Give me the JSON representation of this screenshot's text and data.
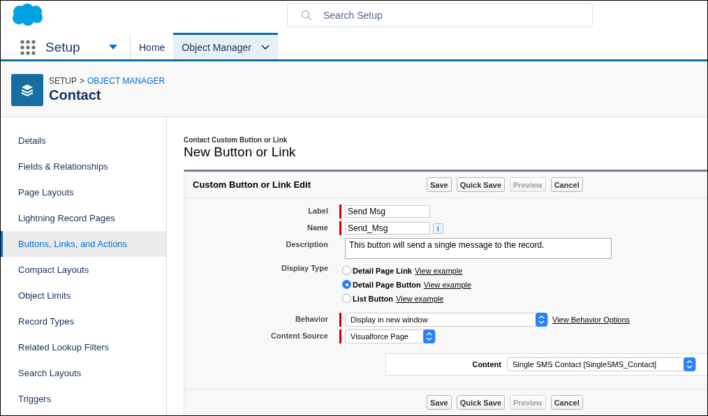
{
  "header": {
    "search": {
      "placeholder": "Search Setup"
    }
  },
  "nav": {
    "app_name": "Setup",
    "tabs": [
      {
        "label": "Home",
        "selected": false,
        "menu": false
      },
      {
        "label": "Object Manager",
        "selected": true,
        "menu": true
      }
    ]
  },
  "object_header": {
    "breadcrumb": [
      {
        "label": "SETUP",
        "link": false
      },
      {
        "label": "OBJECT MANAGER",
        "link": true
      }
    ],
    "separator": ">",
    "title": "Contact"
  },
  "sidebar": {
    "items": [
      {
        "label": "Details",
        "selected": false
      },
      {
        "label": "Fields & Relationships",
        "selected": false
      },
      {
        "label": "Page Layouts",
        "selected": false
      },
      {
        "label": "Lightning Record Pages",
        "selected": false
      },
      {
        "label": "Buttons, Links, and Actions",
        "selected": true
      },
      {
        "label": "Compact Layouts",
        "selected": false
      },
      {
        "label": "Object Limits",
        "selected": false
      },
      {
        "label": "Record Types",
        "selected": false
      },
      {
        "label": "Related Lookup Filters",
        "selected": false
      },
      {
        "label": "Search Layouts",
        "selected": false
      },
      {
        "label": "Triggers",
        "selected": false
      }
    ]
  },
  "form": {
    "eyebrow": "Contact Custom Button or Link",
    "title": "New Button or Link",
    "section_title": "Custom Button or Link Edit",
    "top_buttons": [
      {
        "label": "Save",
        "disabled": false
      },
      {
        "label": "Quick Save",
        "disabled": false
      },
      {
        "label": "Preview",
        "disabled": true
      },
      {
        "label": "Cancel",
        "disabled": false
      }
    ],
    "fields": [
      {
        "kind": "text",
        "label": "Label",
        "value": "Send Msg",
        "required": true
      },
      {
        "kind": "text",
        "label": "Name",
        "value": "Send_Msg",
        "required": true,
        "info": "i"
      },
      {
        "kind": "textarea",
        "label": "Description",
        "value": "This button will send a single message to the record.",
        "required": false
      },
      {
        "kind": "radio",
        "label": "Display Type",
        "options": [
          {
            "label": "Detail Page Link",
            "link": "View example",
            "selected": false
          },
          {
            "label": "Detail Page Button",
            "link": "View example",
            "selected": true
          },
          {
            "label": "List Button",
            "link": "View example",
            "selected": false
          }
        ]
      },
      {
        "kind": "select",
        "label": "Behavior",
        "value": "Display in new window",
        "required": true,
        "link": "View Behavior Options"
      },
      {
        "kind": "select",
        "label": "Content Source",
        "value": "Visualforce Page",
        "required": true
      }
    ],
    "content": {
      "label": "Content",
      "value": "Single SMS Contact [SingleSMS_Contact]"
    },
    "bottom_buttons": [
      {
        "label": "Save",
        "disabled": false
      },
      {
        "label": "Quick Save",
        "disabled": false
      },
      {
        "label": "Preview",
        "disabled": true
      },
      {
        "label": "Cancel",
        "disabled": false
      }
    ]
  }
}
